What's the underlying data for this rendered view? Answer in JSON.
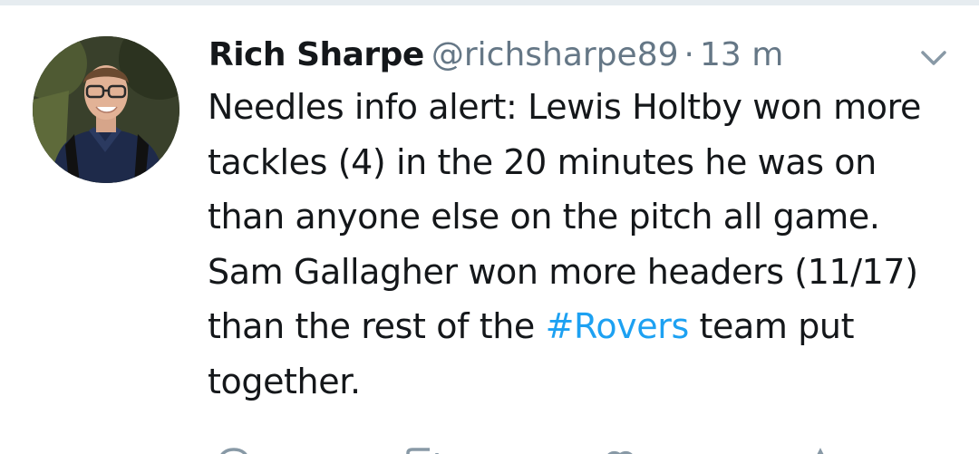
{
  "tweet": {
    "display_name": "Rich Sharpe",
    "handle": "@richsharpe89",
    "separator": "·",
    "time": "13 m",
    "text_before_hashtag": "Needles info alert: Lewis Holtby won more tackles (4) in the 20 minutes he was on than anyone else on the pitch all game. Sam Gallagher won more headers (11/17) than the rest of the ",
    "hashtag": "#Rovers",
    "text_after_hashtag": " team put together."
  },
  "icons": {
    "avatar": "profile-photo",
    "menu": "chevron-down-icon",
    "reply": "reply-icon",
    "retweet": "retweet-icon",
    "like": "heart-icon",
    "share": "share-icon"
  },
  "colors": {
    "text": "#14171a",
    "secondary": "#657786",
    "link": "#1da1f2",
    "divider": "#e6ecf0"
  }
}
